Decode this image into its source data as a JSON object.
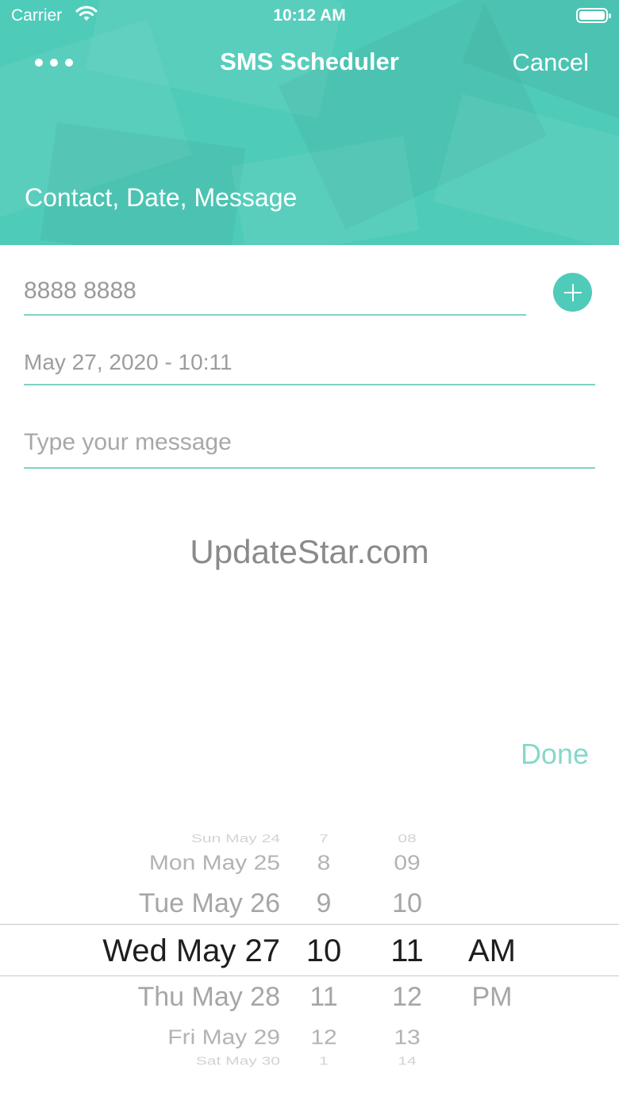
{
  "status_bar": {
    "carrier": "Carrier",
    "time": "10:12 AM"
  },
  "nav": {
    "title": "SMS Scheduler",
    "cancel_label": "Cancel",
    "more_icon": "more-horizontal-icon"
  },
  "header": {
    "section_title": "Contact, Date, Message",
    "background_color": "#4fcbb9"
  },
  "form": {
    "phone_value": "8888 8888",
    "add_contact_icon": "plus-circle-icon",
    "date_value": "May 27, 2020 - 10:11",
    "message_placeholder": "Type your message"
  },
  "watermark": "UpdateStar.com",
  "done_label": "Done",
  "picker": {
    "dates": [
      "Sun May 24",
      "Mon May 25",
      "Tue May 26",
      "Wed May 27",
      "Thu May 28",
      "Fri May 29",
      "Sat May 30"
    ],
    "hours": [
      "7",
      "8",
      "9",
      "10",
      "11",
      "12",
      "1"
    ],
    "minutes": [
      "08",
      "09",
      "10",
      "11",
      "12",
      "13",
      "14"
    ],
    "periods": [
      "AM",
      "PM"
    ],
    "selected": {
      "date": "Wed May 27",
      "hour": "10",
      "minute": "11",
      "period": "AM"
    }
  }
}
